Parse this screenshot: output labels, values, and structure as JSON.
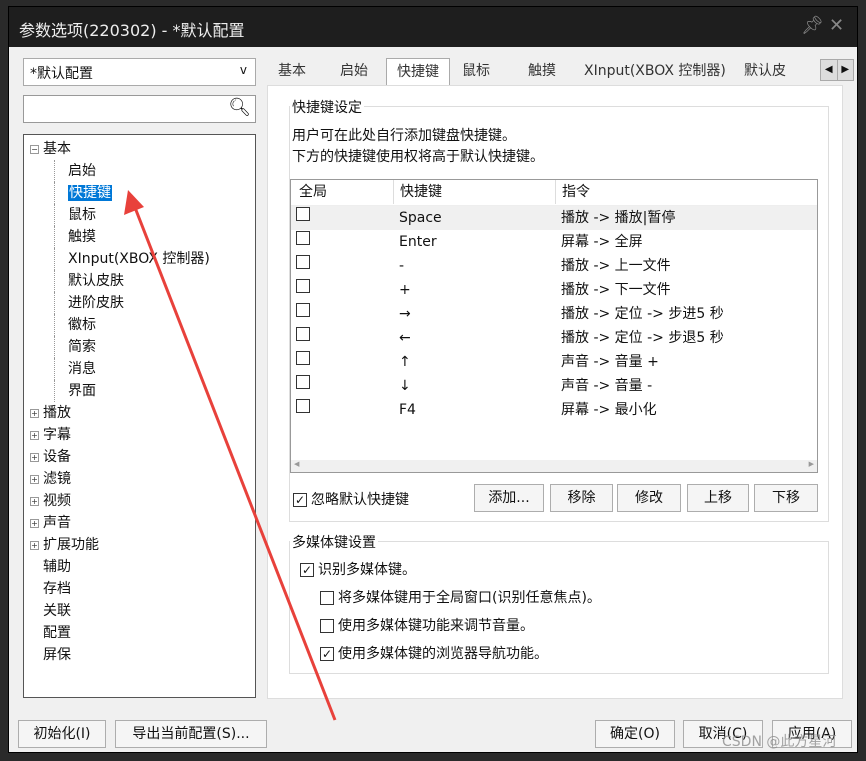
{
  "window": {
    "title": "参数选项(220302) - *默认配置",
    "pin_icon": "pin-icon",
    "close_icon": "close-icon"
  },
  "profile_select": {
    "value": "*默认配置",
    "arrow": "v"
  },
  "search": {
    "value": "",
    "placeholder": ""
  },
  "tree": [
    {
      "label": "基本",
      "expanded": true,
      "children": [
        "启始",
        "快捷键",
        "鼠标",
        "触摸",
        "XInput(XBOX 控制器)",
        "默认皮肤",
        "进阶皮肤",
        "徽标",
        "简索",
        "消息",
        "界面"
      ]
    },
    {
      "label": "播放",
      "expandable": true
    },
    {
      "label": "字幕",
      "expandable": true
    },
    {
      "label": "设备",
      "expandable": true
    },
    {
      "label": "滤镜",
      "expandable": true
    },
    {
      "label": "视频",
      "expandable": true
    },
    {
      "label": "声音",
      "expandable": true
    },
    {
      "label": "扩展功能",
      "expandable": true
    },
    {
      "label": "辅助"
    },
    {
      "label": "存档"
    },
    {
      "label": "关联"
    },
    {
      "label": "配置"
    },
    {
      "label": "屏保"
    }
  ],
  "selected_tree_item": "快捷键",
  "tabs": [
    "基本",
    "启始",
    "快捷键",
    "鼠标",
    "触摸",
    "XInput(XBOX 控制器)",
    "默认皮"
  ],
  "active_tab": "快捷键",
  "hotkey_group": {
    "legend": "快捷键设定",
    "desc1": "用户可在此处自行添加键盘快捷键。",
    "desc2": "下方的快捷键使用权将高于默认快捷键。",
    "columns": [
      "全局",
      "快捷键",
      "指令"
    ],
    "rows": [
      {
        "global": false,
        "key": "Space",
        "command": "播放 -> 播放|暂停"
      },
      {
        "global": false,
        "key": "Enter",
        "command": "屏幕 -> 全屏"
      },
      {
        "global": false,
        "key": "-",
        "command": "播放 -> 上一文件"
      },
      {
        "global": false,
        "key": "+",
        "command": "播放 -> 下一文件"
      },
      {
        "global": false,
        "key": "→",
        "command": "播放 -> 定位 -> 步进5 秒"
      },
      {
        "global": false,
        "key": "←",
        "command": "播放 -> 定位 -> 步退5 秒"
      },
      {
        "global": false,
        "key": "↑",
        "command": "声音 -> 音量 +"
      },
      {
        "global": false,
        "key": "↓",
        "command": "声音 -> 音量 -"
      },
      {
        "global": false,
        "key": "F4",
        "command": "屏幕 -> 最小化"
      }
    ],
    "ignore_default": {
      "label": "忽略默认快捷键",
      "checked": true
    },
    "buttons": {
      "add": "添加...",
      "remove": "移除",
      "edit": "修改",
      "up": "上移",
      "down": "下移"
    }
  },
  "media_group": {
    "legend": "多媒体键设置",
    "options": [
      {
        "label": "识别多媒体键。",
        "checked": true
      },
      {
        "label": "将多媒体键用于全局窗口(识别任意焦点)。",
        "checked": false
      },
      {
        "label": "使用多媒体键功能来调节音量。",
        "checked": false
      },
      {
        "label": "使用多媒体键的浏览器导航功能。",
        "checked": true
      }
    ]
  },
  "footer": {
    "init": "初始化(I)",
    "export": "导出当前配置(S)...",
    "ok": "确定(O)",
    "cancel": "取消(C)",
    "apply": "应用(A)"
  },
  "watermark": "CSDN @此方星河",
  "annotation_color": "#e8413b"
}
